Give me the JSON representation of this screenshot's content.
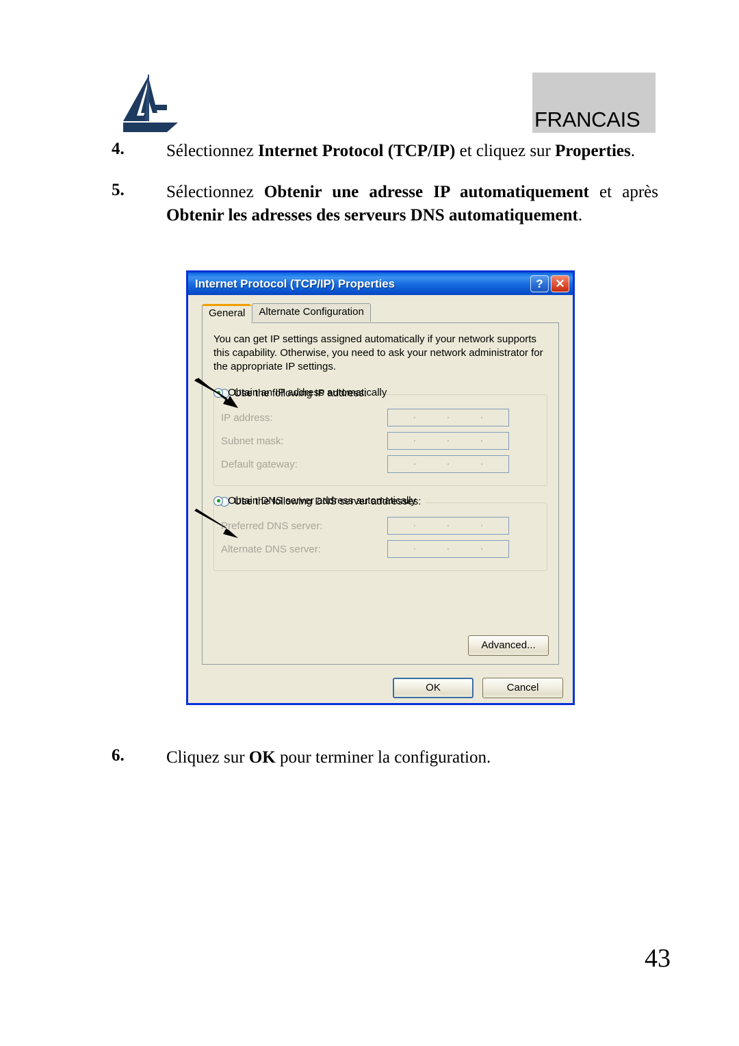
{
  "page": {
    "language_banner": "FRANCAIS",
    "page_number": "43",
    "logo_name": "atlantis-land-logo"
  },
  "steps": [
    {
      "number": "4.",
      "segments": [
        {
          "text": "Sélectionnez ",
          "bold": false
        },
        {
          "text": "Internet Protocol (TCP/IP)",
          "bold": true
        },
        {
          "text": " et cliquez sur ",
          "bold": false
        },
        {
          "text": "Properties",
          "bold": true
        },
        {
          "text": ".",
          "bold": false
        }
      ]
    },
    {
      "number": "5.",
      "segments": [
        {
          "text": "Sélectionnez  ",
          "bold": false
        },
        {
          "text": "Obtenir une adresse IP automatiquement",
          "bold": true
        },
        {
          "text": " et après ",
          "bold": false
        },
        {
          "text": "Obtenir les adresses des serveurs  DNS automatiquement",
          "bold": true
        },
        {
          "text": ".",
          "bold": false
        }
      ]
    },
    {
      "number": "6.",
      "segments": [
        {
          "text": "Cliquez sur  ",
          "bold": false
        },
        {
          "text": "OK",
          "bold": true
        },
        {
          "text": " pour terminer la configuration.",
          "bold": false
        }
      ]
    }
  ],
  "dialog": {
    "title": "Internet Protocol (TCP/IP) Properties",
    "help_button": "?",
    "close_button": "✕",
    "tabs": [
      {
        "label": "General",
        "active": true
      },
      {
        "label": "Alternate Configuration",
        "active": false
      }
    ],
    "description": "You can get IP settings assigned automatically if your network supports this capability. Otherwise, you need to ask your network administrator for the appropriate IP settings.",
    "ip_section": {
      "auto_radio_label": "Obtain an IP address automatically",
      "auto_radio_checked": true,
      "manual_radio_label": "Use the following IP address:",
      "manual_radio_checked": false,
      "fields": [
        {
          "label": "IP address:",
          "value": ""
        },
        {
          "label": "Subnet mask:",
          "value": ""
        },
        {
          "label": "Default gateway:",
          "value": ""
        }
      ]
    },
    "dns_section": {
      "auto_radio_label": "Obtain DNS server address automatically",
      "auto_radio_checked": true,
      "manual_radio_label": "Use the following DNS server addresses:",
      "manual_radio_checked": false,
      "fields": [
        {
          "label": "Preferred DNS server:",
          "value": ""
        },
        {
          "label": "Alternate DNS server:",
          "value": ""
        }
      ]
    },
    "advanced_button": "Advanced...",
    "ok_button": "OK",
    "cancel_button": "Cancel"
  },
  "colors": {
    "titlebar_blue": "#0a55cf",
    "dialog_face": "#ece9d8",
    "logo_navy": "#1f3a5f",
    "banner_gray": "#cccccc",
    "radio_green": "#1a9e1a",
    "tab_accent_orange": "#f0a000",
    "close_red": "#c42a10"
  }
}
